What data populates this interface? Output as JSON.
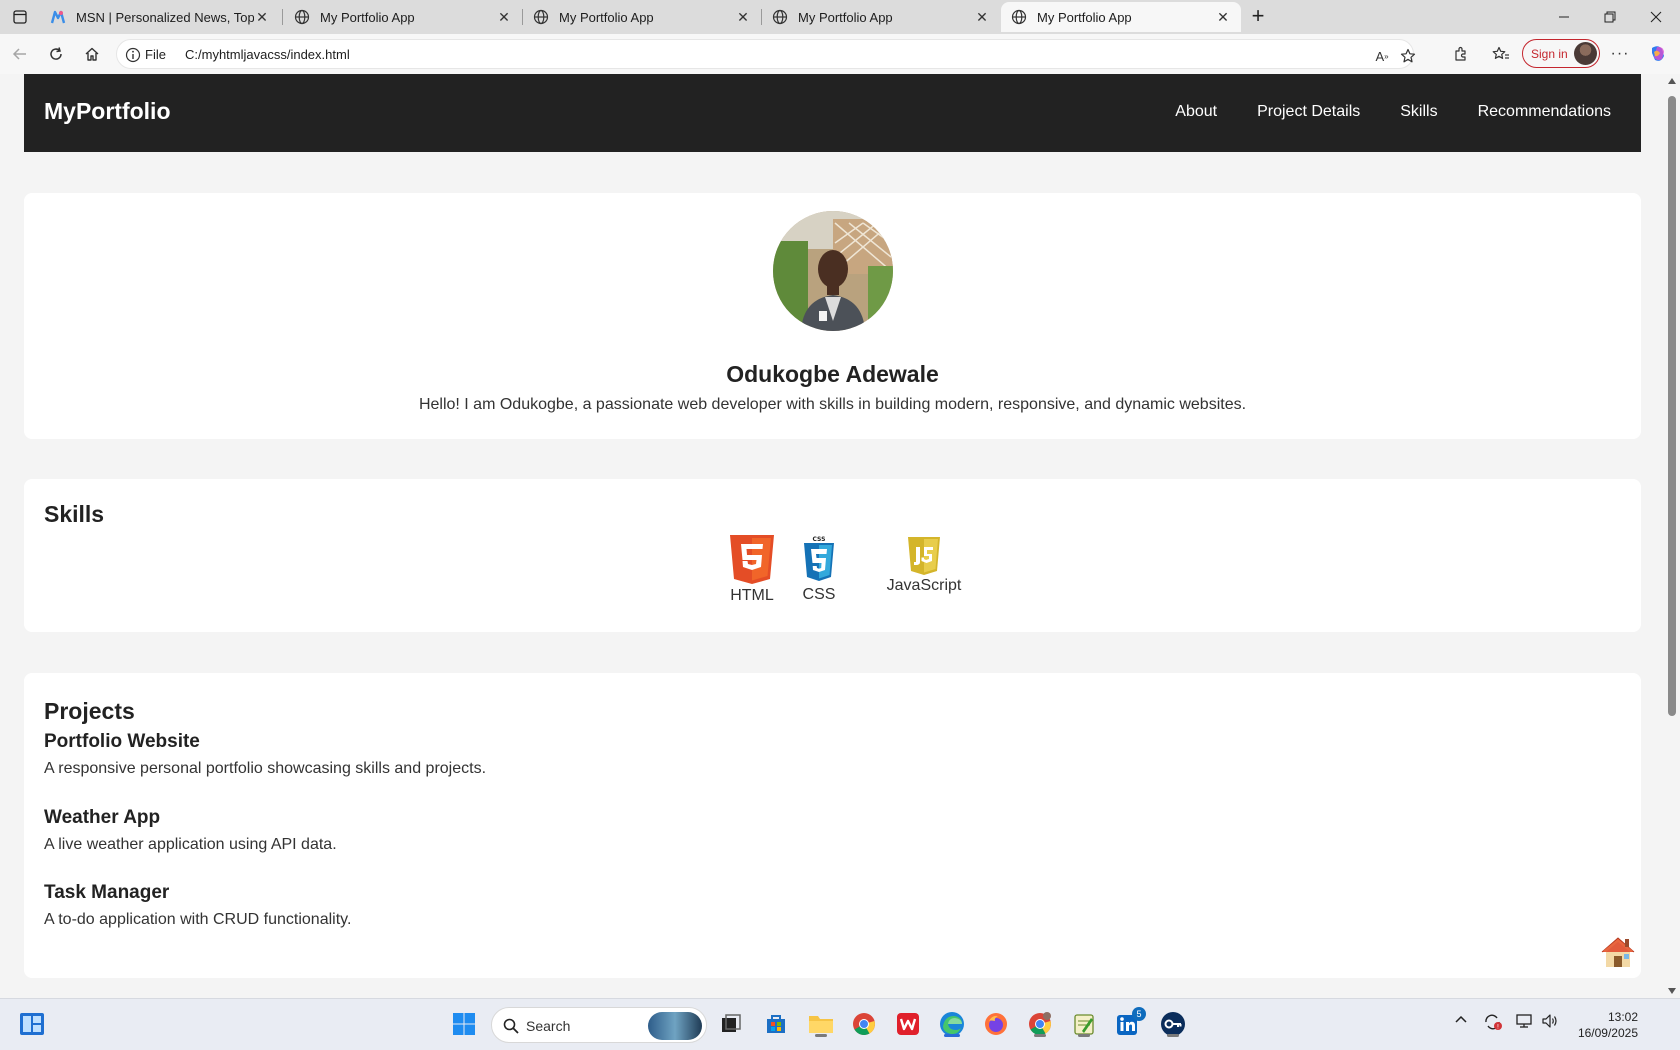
{
  "browser": {
    "tabs": [
      {
        "title": "MSN | Personalized News, Top He",
        "icon": "msn-icon",
        "active": false
      },
      {
        "title": "My Portfolio App",
        "icon": "globe-icon",
        "active": false
      },
      {
        "title": "My Portfolio App",
        "icon": "globe-icon",
        "active": false
      },
      {
        "title": "My Portfolio App",
        "icon": "globe-icon",
        "active": false
      },
      {
        "title": "My Portfolio App",
        "icon": "globe-icon",
        "active": true
      }
    ],
    "address": {
      "scheme": "File",
      "url": "C:/myhtmljavacss/index.html"
    },
    "signin_label": "Sign in"
  },
  "page": {
    "nav": {
      "logo": "MyPortfolio",
      "links": [
        "About",
        "Project Details",
        "Skills",
        "Recommendations"
      ]
    },
    "hero": {
      "name": "Odukogbe Adewale",
      "bio": "Hello! I am Odukogbe, a passionate web developer with skills in building modern, responsive, and dynamic websites."
    },
    "skills": {
      "title": "Skills",
      "items": [
        {
          "label": "HTML",
          "icon": "html5-icon",
          "color": "#e44d26"
        },
        {
          "label": "CSS",
          "icon": "css3-icon",
          "color": "#1572b6"
        },
        {
          "label": "JavaScript",
          "icon": "js-icon",
          "color": "#d4b52a"
        }
      ]
    },
    "projects": {
      "title": "Projects",
      "items": [
        {
          "title": "Portfolio Website",
          "desc": "A responsive personal portfolio showcasing skills and projects."
        },
        {
          "title": "Weather App",
          "desc": "A live weather application using API data."
        },
        {
          "title": "Task Manager",
          "desc": "A to-do application with CRUD functionality."
        }
      ]
    }
  },
  "taskbar": {
    "search_label": "Search",
    "time": "13:02",
    "date": "16/09/2025",
    "linkedin_badge": "5"
  }
}
